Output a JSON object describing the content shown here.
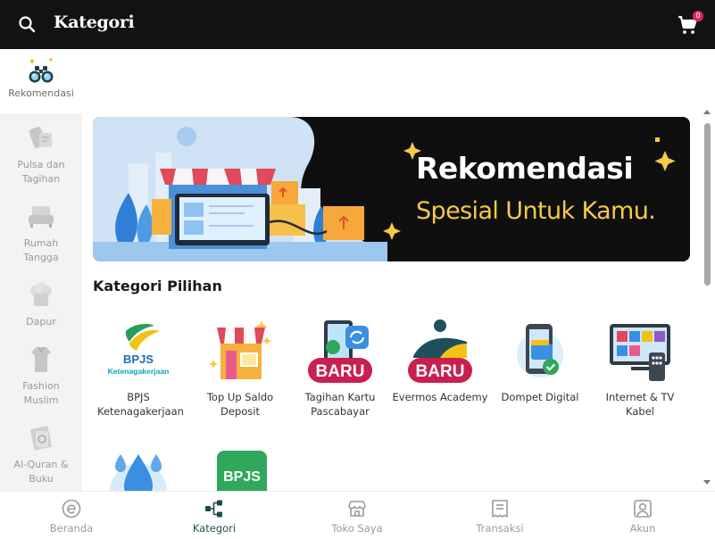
{
  "header": {
    "title": "Kategori",
    "cart_count": "0"
  },
  "sidebar": {
    "items": [
      {
        "label": "Rekomendasi",
        "icon": "binoculars-icon",
        "active": true
      },
      {
        "label": "Pulsa dan Tagihan",
        "icon": "phone-bill-icon"
      },
      {
        "label": "Rumah Tangga",
        "icon": "sofa-icon"
      },
      {
        "label": "Dapur",
        "icon": "chef-hat-icon"
      },
      {
        "label": "Fashion Muslim",
        "icon": "clothing-icon"
      },
      {
        "label": "Al-Quran & Buku",
        "icon": "book-icon"
      }
    ]
  },
  "banner": {
    "title": "Rekomendasi",
    "subtitle": "Spesial Untuk Kamu."
  },
  "section": {
    "title": "Kategori Pilihan"
  },
  "categories": [
    {
      "label": "BPJS Ketenagakerjaan",
      "icon": "bpjs-ketenagakerjaan-logo",
      "logo_text": "BPJS",
      "logo_sub": "Ketenagakerjaan"
    },
    {
      "label": "Top Up Saldo Deposit",
      "icon": "store-icon"
    },
    {
      "label": "Tagihan Kartu Pascabayar",
      "icon": "phone-refresh-icon",
      "badge": "BARU"
    },
    {
      "label": "Evermos Academy",
      "icon": "academy-icon",
      "badge": "BARU"
    },
    {
      "label": "Dompet Digital",
      "icon": "wallet-phone-icon"
    },
    {
      "label": "Internet & TV Kabel",
      "icon": "tv-icon"
    },
    {
      "label": "",
      "icon": "water-drop-icon"
    },
    {
      "label": "",
      "icon": "bpjs-kesehatan-icon",
      "logo_text": "BPJS"
    }
  ],
  "bottom_nav": [
    {
      "label": "Beranda",
      "icon": "home-e-icon"
    },
    {
      "label": "Kategori",
      "icon": "category-network-icon",
      "active": true
    },
    {
      "label": "Toko Saya",
      "icon": "shop-icon"
    },
    {
      "label": "Transaksi",
      "icon": "receipt-icon"
    },
    {
      "label": "Akun",
      "icon": "account-icon"
    }
  ],
  "colors": {
    "header_bg": "#121212",
    "accent_active": "#1d4a4a",
    "badge_pink": "#c8204f",
    "banner_yellow": "#f7c948",
    "sidebar_bg": "#f3f3f3"
  }
}
